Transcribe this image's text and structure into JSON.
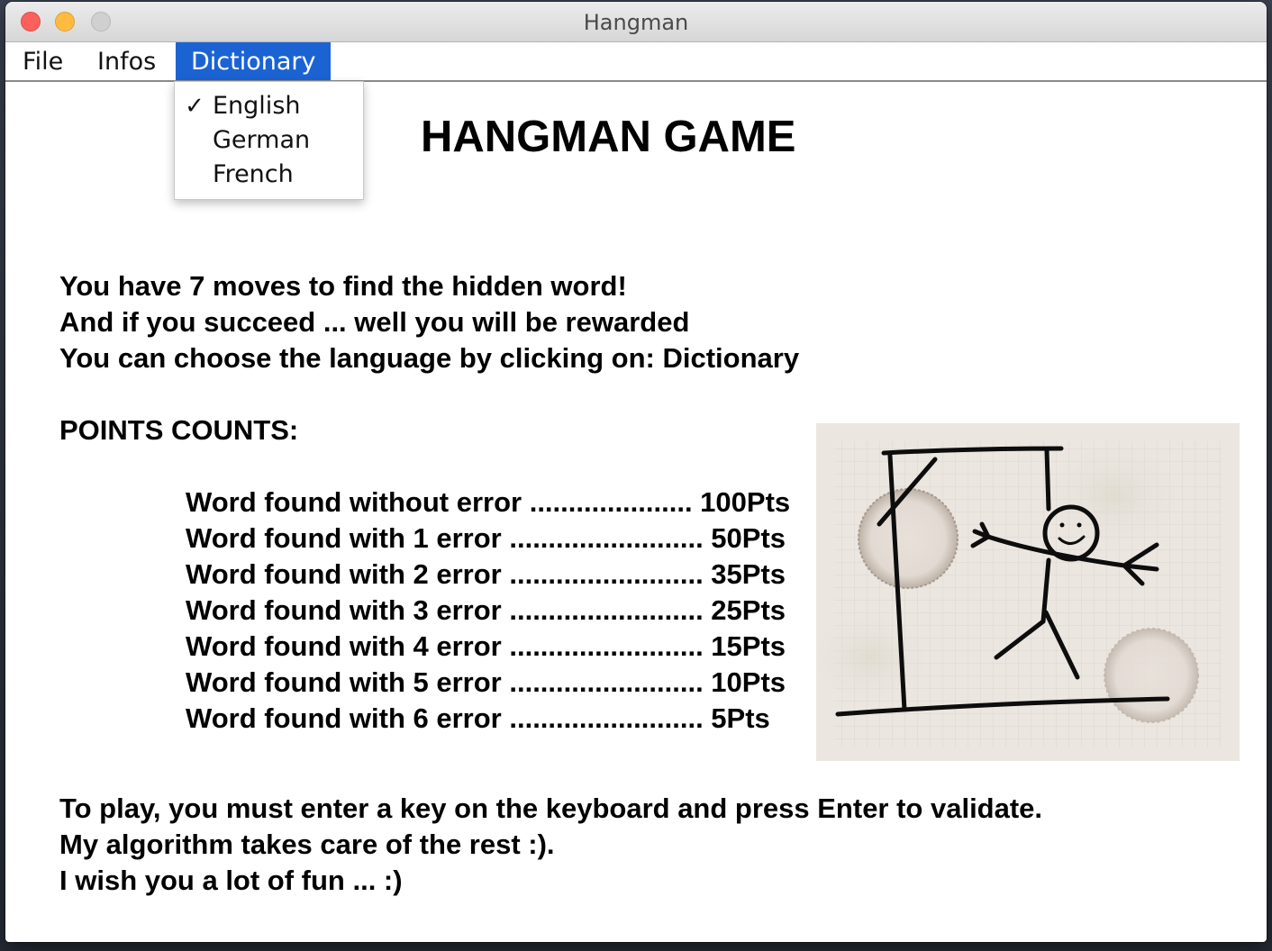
{
  "window": {
    "title": "Hangman"
  },
  "menubar": {
    "items": [
      {
        "label": "File"
      },
      {
        "label": "Infos"
      },
      {
        "label": "Dictionary"
      }
    ]
  },
  "dictionary_menu": {
    "items": [
      {
        "label": "English",
        "checked": true,
        "check_mark": "✓"
      },
      {
        "label": "German",
        "checked": false
      },
      {
        "label": "French",
        "checked": false
      }
    ]
  },
  "main": {
    "title": "HANGMAN GAME",
    "intro_lines": [
      "You have 7 moves to find the hidden word!",
      "And if you succeed ... well you will be rewarded",
      "You can choose the language by clicking on: Dictionary"
    ],
    "points_heading": "POINTS COUNTS:",
    "points_lines": [
      "Word found without error ..................... 100Pts",
      "Word found with 1 error ......................... 50Pts",
      "Word found with 2 error ......................... 35Pts",
      "Word found with 3 error ......................... 25Pts",
      "Word found with 4 error ......................... 15Pts",
      "Word found with 5 error ......................... 10Pts",
      "Word found with 6 error ......................... 5Pts"
    ],
    "instruction_lines": [
      "To play, you must enter a key on the keyboard and press Enter to validate.",
      "My algorithm takes care of the rest :).",
      "I wish you a lot of fun ... :)"
    ]
  },
  "colors": {
    "menu_highlight": "#1b63d3",
    "close_button": "#fc605c",
    "minimize_button": "#fdbc40",
    "zoom_button": "#d0d0d0"
  }
}
